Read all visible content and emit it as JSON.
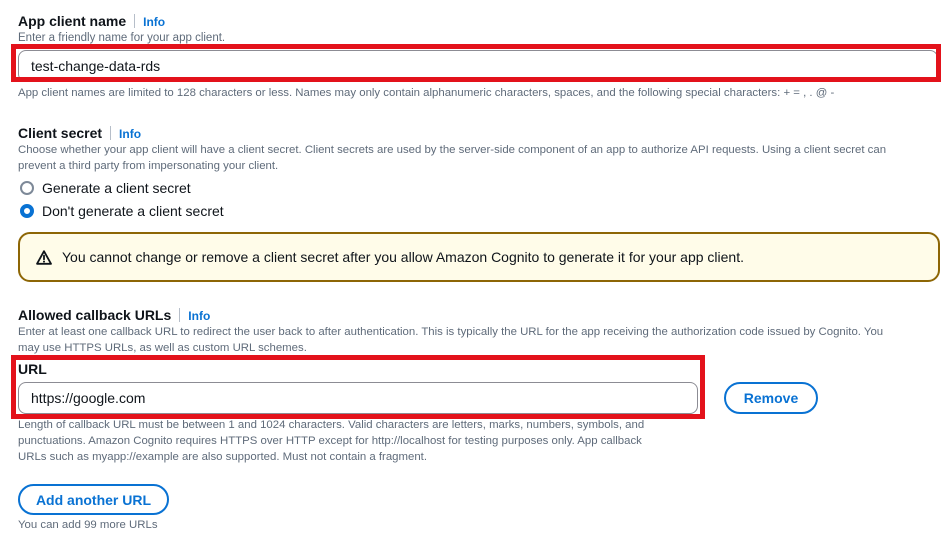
{
  "app_client_name": {
    "label": "App client name",
    "info": "Info",
    "description": "Enter a friendly name for your app client.",
    "value": "test-change-data-rds",
    "constraint": "App client names are limited to 128 characters or less. Names may only contain alphanumeric characters, spaces, and the following special characters: + = , . @ -"
  },
  "client_secret": {
    "label": "Client secret",
    "info": "Info",
    "description_line1": "Choose whether your app client will have a client secret. Client secrets are used by the server-side component of an app to authorize API requests. Using a client secret can",
    "description_line2": "prevent a third party from impersonating your client.",
    "options": [
      {
        "label": "Generate a client secret",
        "selected": false
      },
      {
        "label": "Don't generate a client secret",
        "selected": true
      }
    ],
    "warning": "You cannot change or remove a client secret after you allow Amazon Cognito to generate it for your app client."
  },
  "callback_urls": {
    "label": "Allowed callback URLs",
    "info": "Info",
    "description_line1": "Enter at least one callback URL to redirect the user back to after authentication. This is typically the URL for the app receiving the authorization code issued by Cognito. You",
    "description_line2": "may use HTTPS URLs, as well as custom URL schemes.",
    "url_label": "URL",
    "url_value": "https://google.com",
    "remove_label": "Remove",
    "constraint_line1": "Length of callback URL must be between 1 and 1024 characters. Valid characters are letters, marks, numbers, symbols, and",
    "constraint_line2": "punctuations. Amazon Cognito requires HTTPS over HTTP except for http://localhost for testing purposes only. App callback",
    "constraint_line3": "URLs such as myapp://example are also supported. Must not contain a fragment.",
    "add_label": "Add another URL",
    "remaining": "You can add 99 more URLs"
  },
  "colors": {
    "accent": "#0972d3",
    "highlight": "#e3121b",
    "warning_border": "#8d6605",
    "warning_bg": "#fffce9"
  }
}
